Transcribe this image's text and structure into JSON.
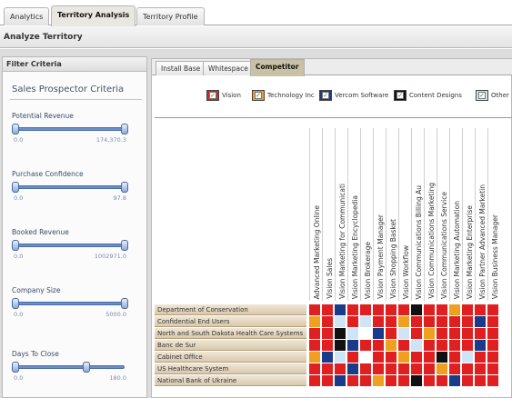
{
  "app_tabs": [
    "Analytics",
    "Territory Analysis",
    "Territory Profile"
  ],
  "panel_title": "Analyze Territory",
  "filter": {
    "header": "Filter Criteria",
    "criteria_title": "Sales Prospector Criteria",
    "sliders": [
      {
        "label": "Potential Revenue",
        "min": "0.0",
        "max": "174,370.3"
      },
      {
        "label": "Purchase Confidence",
        "min": "0.0",
        "max": "97.8"
      },
      {
        "label": "Booked Revenue",
        "min": "0.0",
        "max": "1002971.0"
      },
      {
        "label": "Company Size",
        "min": "0.0",
        "max": "5000.0"
      },
      {
        "label": "Days To Close",
        "min": "0.0",
        "max": "180.0"
      }
    ]
  },
  "sub_tabs": [
    "Install Base",
    "Whitespace",
    "Competitor"
  ],
  "legend": [
    {
      "label": "Vision",
      "color": "#e02020"
    },
    {
      "label": "Technology Inc",
      "color": "#f0a020"
    },
    {
      "label": "Vercom Software",
      "color": "#1a3a8a"
    },
    {
      "label": "Content Designs",
      "color": "#111111"
    },
    {
      "label": "Other",
      "color": "#cfe4f5"
    }
  ],
  "columns": [
    "Advanced Marketing Online",
    "Vision Sales",
    "Vision Marketing for Communicati",
    "Vision Marketing Encyclopedia",
    "Vision Brokerage",
    "Vision Payment Manager",
    "Vision Shopping Basket",
    "Vision Workflow",
    "Vision Communications Billing Au",
    "Vision Communications Marketing",
    "Vision Communications Service",
    "Vision Marketing Automation",
    "Vision Marketing Enterprise",
    "Vision Partner Advanced Marketin",
    "Vision Business Manager"
  ],
  "rows": [
    {
      "label": "Department of Conservation",
      "cells": [
        "red",
        "red",
        "blue",
        "red",
        "red",
        "red",
        "red",
        "red",
        "black",
        "red",
        "red",
        "orange",
        "red",
        "red",
        "red"
      ]
    },
    {
      "label": "Confidential End Users",
      "cells": [
        "orange",
        "red",
        "light",
        "red",
        "light",
        "red",
        "red",
        "orange",
        "red",
        "red",
        "red",
        "red",
        "red",
        "blue",
        "red"
      ]
    },
    {
      "label": "North and South Dakota Health Care Systems",
      "cells": [
        "red",
        "red",
        "black",
        "light",
        "white",
        "blue",
        "red",
        "light",
        "red",
        "orange",
        "red",
        "red",
        "red",
        "red",
        "red"
      ]
    },
    {
      "label": "Banc de Sur",
      "cells": [
        "red",
        "red",
        "black",
        "blue",
        "red",
        "red",
        "orange",
        "red",
        "light",
        "red",
        "red",
        "red",
        "red",
        "blue",
        "red"
      ]
    },
    {
      "label": "Cabinet Office",
      "cells": [
        "orange",
        "blue",
        "light",
        "red",
        "white",
        "red",
        "red",
        "orange",
        "red",
        "red",
        "black",
        "red",
        "light",
        "red",
        "red"
      ]
    },
    {
      "label": "US Healthcare System",
      "cells": [
        "red",
        "red",
        "red",
        "blue",
        "red",
        "red",
        "red",
        "red",
        "red",
        "red",
        "orange",
        "red",
        "red",
        "red",
        "red"
      ]
    },
    {
      "label": "National Bank of Ukraine",
      "cells": [
        "red",
        "red",
        "blue",
        "red",
        "red",
        "orange",
        "red",
        "red",
        "black",
        "red",
        "red",
        "blue",
        "red",
        "red",
        "red"
      ]
    }
  ],
  "cell_colors": {
    "red": "#e02020",
    "orange": "#f0a020",
    "blue": "#1a3a8a",
    "black": "#111111",
    "light": "#cfe4f5",
    "white": "#ffffff"
  }
}
